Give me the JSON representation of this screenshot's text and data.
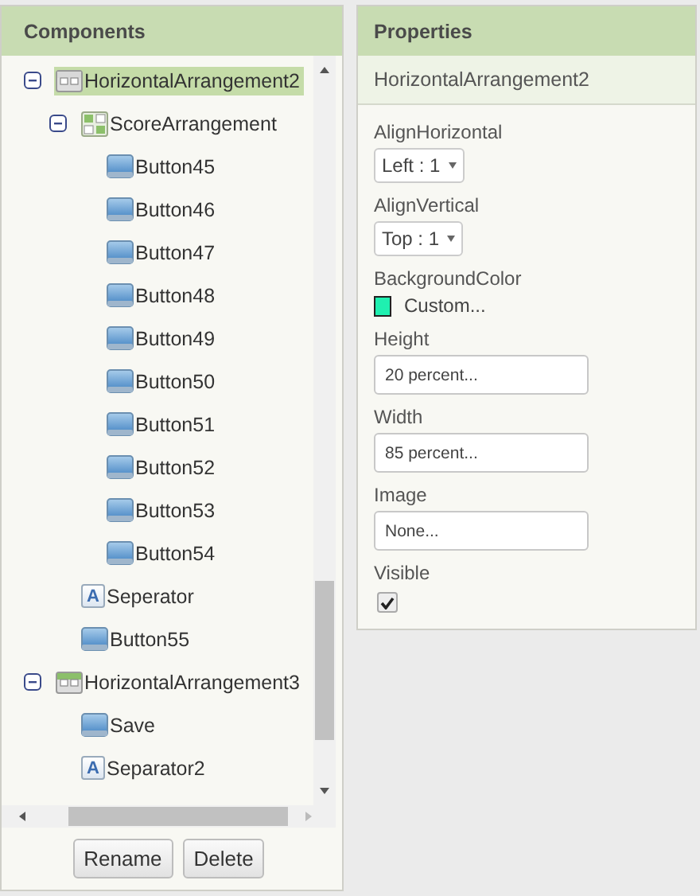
{
  "components": {
    "title": "Components",
    "tree": [
      {
        "name": "HorizontalArrangement2",
        "kind": "arrangement",
        "selected": true,
        "expanded": true,
        "children": [
          {
            "name": "ScoreArrangement",
            "kind": "table",
            "selected": false,
            "expanded": true,
            "children": [
              {
                "name": "Button45",
                "kind": "button",
                "selected": false
              },
              {
                "name": "Button46",
                "kind": "button",
                "selected": false
              },
              {
                "name": "Button47",
                "kind": "button",
                "selected": false
              },
              {
                "name": "Button48",
                "kind": "button",
                "selected": false
              },
              {
                "name": "Button49",
                "kind": "button",
                "selected": false
              },
              {
                "name": "Button50",
                "kind": "button",
                "selected": false
              },
              {
                "name": "Button51",
                "kind": "button",
                "selected": false
              },
              {
                "name": "Button52",
                "kind": "button",
                "selected": false
              },
              {
                "name": "Button53",
                "kind": "button",
                "selected": false
              },
              {
                "name": "Button54",
                "kind": "button",
                "selected": false
              }
            ]
          },
          {
            "name": "Seperator",
            "kind": "label",
            "icon_glyph": "A",
            "selected": false
          },
          {
            "name": "Button55",
            "kind": "button",
            "selected": false
          }
        ]
      },
      {
        "name": "HorizontalArrangement3",
        "kind": "arrangement",
        "selected": false,
        "expanded": true,
        "children": [
          {
            "name": "Save",
            "kind": "button",
            "selected": false
          },
          {
            "name": "Separator2",
            "kind": "label",
            "icon_glyph": "A",
            "selected": false
          }
        ]
      }
    ],
    "buttons": [
      "Rename",
      "Delete"
    ]
  },
  "properties": {
    "title": "Properties",
    "component": "HorizontalArrangement2",
    "items": [
      {
        "label": "AlignHorizontal",
        "kind": "dropdown",
        "value": "Left : 1"
      },
      {
        "label": "AlignVertical",
        "kind": "dropdown",
        "value": "Top : 1"
      },
      {
        "label": "BackgroundColor",
        "kind": "color",
        "value": "Custom...",
        "color": "#1ff0b0"
      },
      {
        "label": "Height",
        "kind": "textbox",
        "value": "20 percent..."
      },
      {
        "label": "Width",
        "kind": "textbox",
        "value": "85 percent..."
      },
      {
        "label": "Image",
        "kind": "textbox",
        "value": "None..."
      },
      {
        "label": "Visible",
        "kind": "checkbox",
        "checked": true
      }
    ]
  }
}
